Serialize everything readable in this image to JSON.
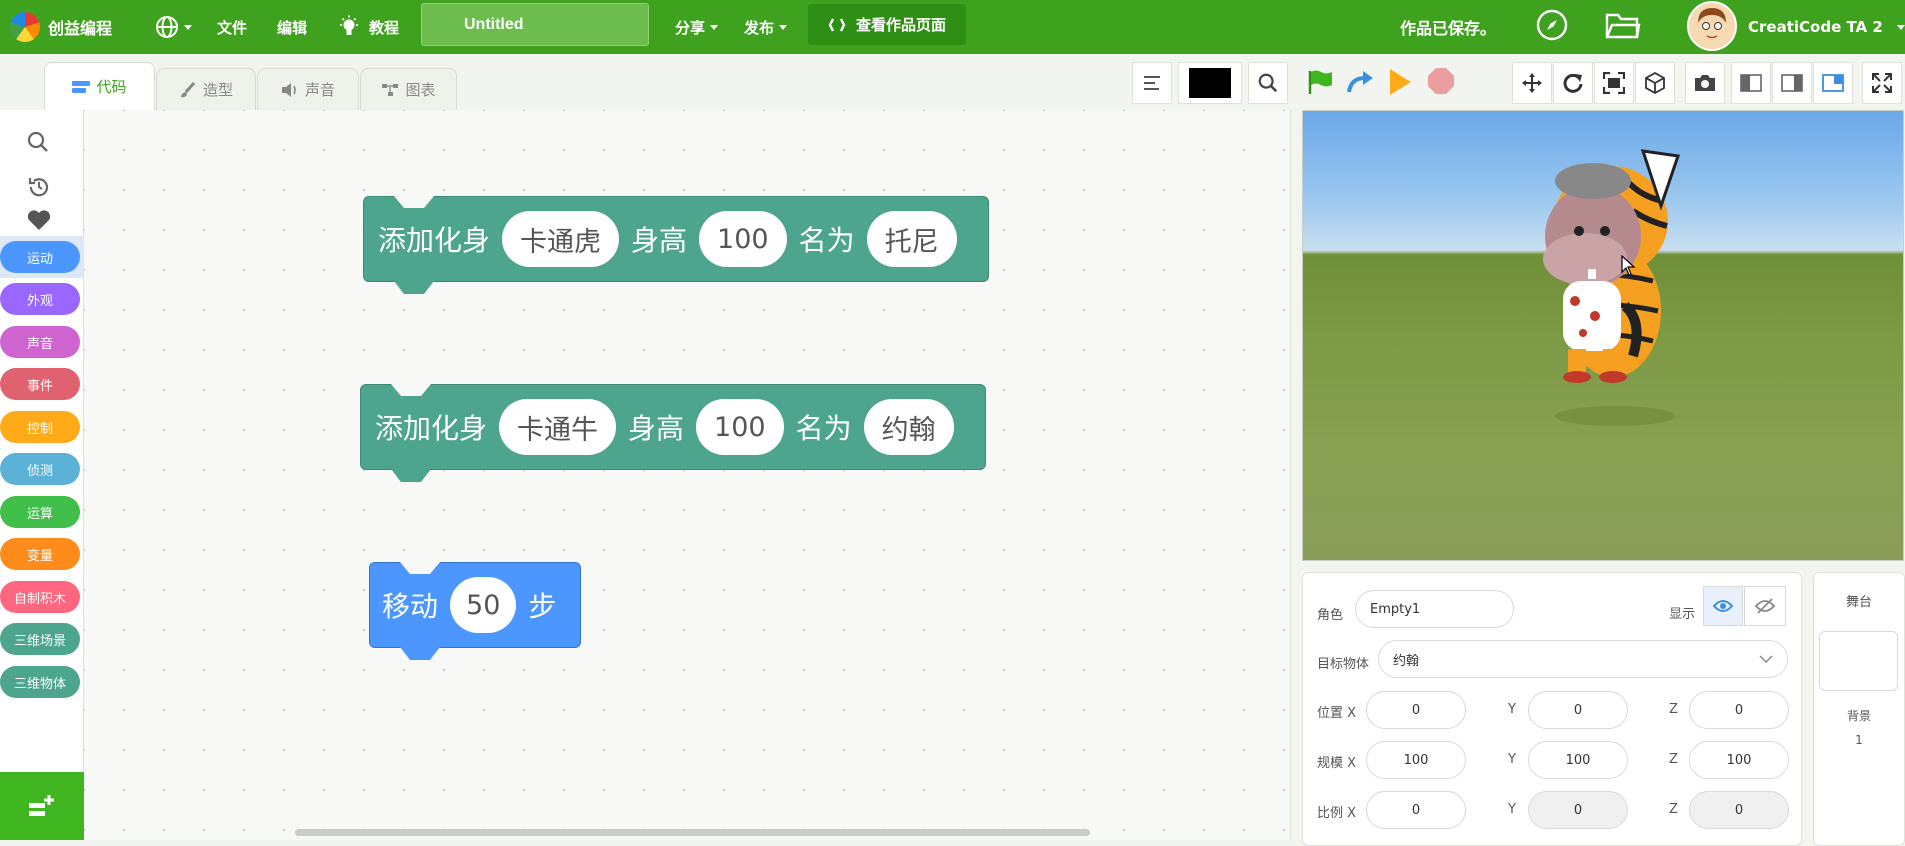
{
  "topbar": {
    "brand": "创益编程",
    "menu": {
      "file": "文件",
      "edit": "编辑",
      "tutorial": "教程",
      "share": "分享",
      "publish": "发布"
    },
    "project_title": "Untitled",
    "view_page": "查看作品页面",
    "saved_status": "作品已保存。",
    "username": "CreatiCode TA 2"
  },
  "tabs": {
    "code": "代码",
    "costume": "造型",
    "sound": "声音",
    "chart": "图表"
  },
  "categories": [
    {
      "label": "运动",
      "color": "#4c97ff"
    },
    {
      "label": "外观",
      "color": "#9966ff"
    },
    {
      "label": "声音",
      "color": "#cf63cf"
    },
    {
      "label": "事件",
      "color": "#e0626f"
    },
    {
      "label": "控制",
      "color": "#ffab19"
    },
    {
      "label": "侦测",
      "color": "#5cb1d6"
    },
    {
      "label": "运算",
      "color": "#40bf4a"
    },
    {
      "label": "变量",
      "color": "#ff8c1a"
    },
    {
      "label": "自制积木",
      "color": "#ff6680"
    },
    {
      "label": "三维场景",
      "color": "#4ea58d"
    },
    {
      "label": "三维物体",
      "color": "#4ea58d"
    }
  ],
  "blocks": {
    "b1": {
      "add": "添加化身",
      "avatar": "卡通虎",
      "height_label": "身高",
      "height": "100",
      "name_label": "名为",
      "name": "托尼"
    },
    "b2": {
      "add": "添加化身",
      "avatar": "卡通牛",
      "height_label": "身高",
      "height": "100",
      "name_label": "名为",
      "name": "约翰"
    },
    "b3": {
      "move": "移动",
      "steps": "50",
      "unit": "步"
    }
  },
  "props": {
    "sprite_label": "角色",
    "sprite_name": "Empty1",
    "show_label": "显示",
    "target_label": "目标物体",
    "target_value": "约翰",
    "position_label": "位置 X",
    "scale_label": "规模 X",
    "ratio_label": "比例 X",
    "y": "Y",
    "z": "Z",
    "pos": [
      "0",
      "0",
      "0"
    ],
    "scale": [
      "100",
      "100",
      "100"
    ],
    "ratio": [
      "0",
      "0",
      "0"
    ]
  },
  "stage_panel": {
    "title": "舞台",
    "backdrop_label": "背景",
    "backdrop_count": "1"
  },
  "colors": {
    "brand_green": "#3fa21e",
    "block_teal": "#4ea58d",
    "block_blue": "#4c97ff"
  }
}
